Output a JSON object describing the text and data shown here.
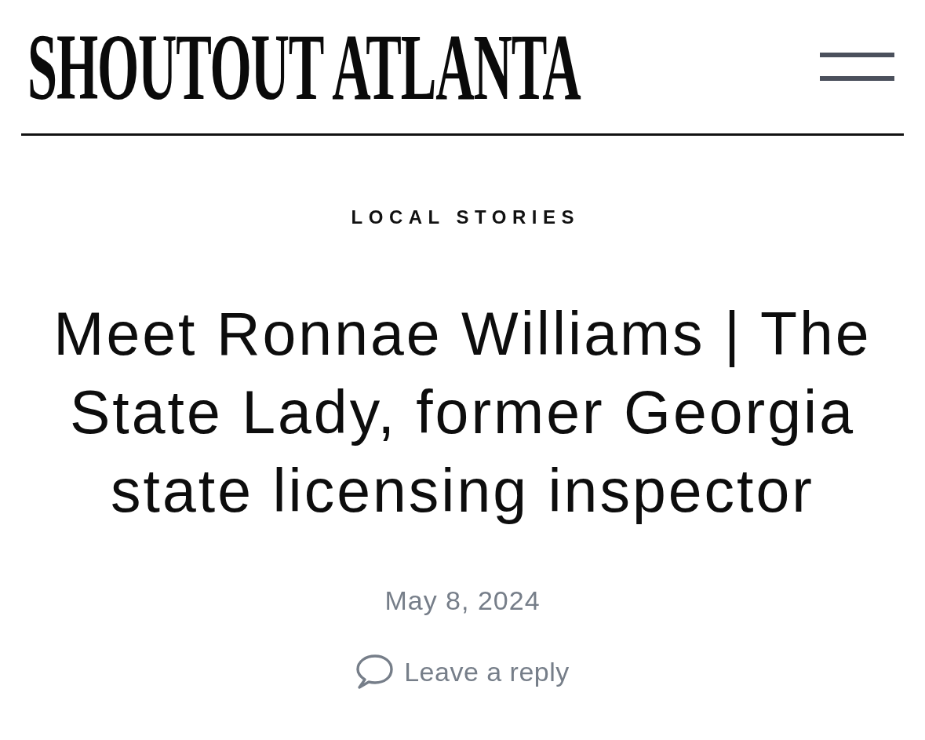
{
  "site": {
    "logo": "SHOUTOUT ATLANTA"
  },
  "article": {
    "category": "LOCAL STORIES",
    "title": "Meet Ronnae Williams | The State Lady, former Georgia state licensing inspector",
    "date": "May 8, 2024",
    "reply_link": "Leave a reply"
  }
}
